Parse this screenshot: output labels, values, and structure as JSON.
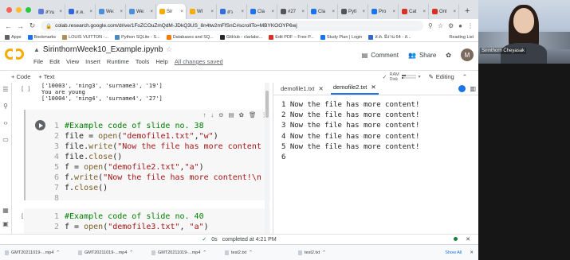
{
  "browser": {
    "tabs": [
      {
        "label": "ส่วน",
        "color": "#5b7bd5"
      },
      {
        "label": "ส.ต.",
        "color": "#3367d6"
      },
      {
        "label": "We:",
        "color": "#4a90d9"
      },
      {
        "label": "We:",
        "color": "#4a90d9"
      },
      {
        "label": "Sir",
        "color": "#f9ab00",
        "active": true
      },
      {
        "label": "WI",
        "color": "#f9ab00"
      },
      {
        "label": "ส่ว",
        "color": "#2f6edb"
      },
      {
        "label": "Cla",
        "color": "#1a73e8"
      },
      {
        "label": "#27",
        "color": "#555555"
      },
      {
        "label": "Cla",
        "color": "#1a73e8"
      },
      {
        "label": "Pytl",
        "color": "#555555"
      },
      {
        "label": "Pro",
        "color": "#1a73e8"
      },
      {
        "label": "Cat",
        "color": "#d93025"
      },
      {
        "label": "Onl",
        "color": "#d93025"
      }
    ],
    "tab_close": "×",
    "new_tab": "+",
    "url": "colab.research.google.com/drive/1FoZCOuZmQdM-JDkQ3US_8n4tw2mFfSnC#scrollTo=MBYKOOYP6wj",
    "bookmarks": [
      {
        "label": "Apps"
      },
      {
        "label": "Bookmarks"
      },
      {
        "label": "LOUIS VUITTON -..."
      },
      {
        "label": "Python SQLite - S..."
      },
      {
        "label": "Databases and SQ..."
      },
      {
        "label": "GitHub - clarlabz..."
      },
      {
        "label": "Edit PDF – Free P..."
      },
      {
        "label": "Study Plan | Login"
      },
      {
        "label": "ส.ต. มีงาน 64 - ส..."
      }
    ],
    "reading_list": "Reading List"
  },
  "colab": {
    "title": "SirinthornWeek10_Example.ipynb",
    "menu": [
      "File",
      "Edit",
      "View",
      "Insert",
      "Runtime",
      "Tools",
      "Help"
    ],
    "changes_saved": "All changes saved",
    "comment": "Comment",
    "share": "Share",
    "avatar_letter": "M",
    "add_code": "+ Code",
    "add_text": "+ Text",
    "ram": "RAM",
    "disk": "Disk",
    "ram_fill": 0.3,
    "disk_fill": 0.15,
    "editing": "Editing",
    "prev_cell_num": "[ ]",
    "prev_output": "['10003', 'ning3', 'surname3', '19']\nYou are young\n['10004', 'ning4', 'surname4', '27']",
    "cell1": {
      "lines": [
        {
          "n": "1",
          "text": "#Example code of slide no. 38",
          "kind": "comment"
        },
        {
          "n": "2",
          "text": "file = open(\"demofile1.txt\",\"w\")",
          "kind": "code"
        },
        {
          "n": "3",
          "text": "file.write(\"Now the file has more content",
          "kind": "code"
        },
        {
          "n": "4",
          "text": "file.close()",
          "kind": "code"
        },
        {
          "n": "5",
          "text": "f = open(\"demofile2.txt\",\"a\")",
          "kind": "code"
        },
        {
          "n": "6",
          "text": "f.write(\"Now the file has more content!\\n",
          "kind": "code"
        },
        {
          "n": "7",
          "text": "f.close()",
          "kind": "code"
        },
        {
          "n": "8",
          "text": "",
          "kind": "code"
        }
      ]
    },
    "cell2_num": "[ ]",
    "cell2": {
      "lines": [
        {
          "n": "1",
          "text": "#Example code of slide no. 40",
          "kind": "comment"
        },
        {
          "n": "2",
          "text": "f = open(\"demofile3.txt\", \"a\")",
          "kind": "code"
        }
      ]
    },
    "viewer_tabs": [
      "demofile1.txt",
      "demofile2.txt"
    ],
    "file_lines": [
      "1 Now the file has more content!",
      "2 Now the file has more content!",
      "3 Now the file has more content!",
      "4 Now the file has more content!",
      "5 Now the file has more content!",
      "6"
    ],
    "status_check": "✓",
    "status_time": "0s",
    "status_text": "completed at 4:21 PM"
  },
  "downloads": {
    "items": [
      "GMT20211019-...mp4",
      "GMT20211019-...mp4",
      "GMT20211019-...mp4",
      "test2.txt",
      "test2.txt"
    ],
    "show_all": "Show All"
  },
  "webcam": {
    "name": "Sirinthorn Cheyasak"
  }
}
